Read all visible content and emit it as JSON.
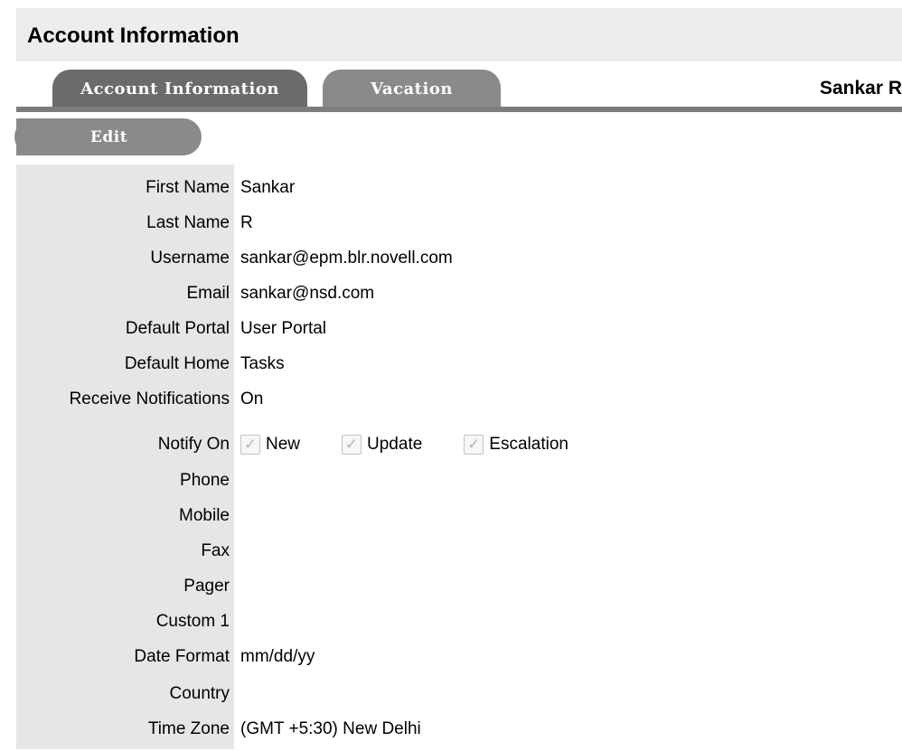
{
  "page": {
    "title": "Account Information"
  },
  "tabs": [
    {
      "label": "Account Information",
      "active": true
    },
    {
      "label": "Vacation",
      "active": false
    }
  ],
  "user": {
    "display_name": "Sankar R"
  },
  "toolbar": {
    "edit_label": "Edit"
  },
  "fields": {
    "first_name": {
      "label": "First Name",
      "value": "Sankar"
    },
    "last_name": {
      "label": "Last Name",
      "value": "R"
    },
    "username": {
      "label": "Username",
      "value": "sankar@epm.blr.novell.com"
    },
    "email": {
      "label": "Email",
      "value": "sankar@nsd.com"
    },
    "default_portal": {
      "label": "Default Portal",
      "value": "User Portal"
    },
    "default_home": {
      "label": "Default Home",
      "value": "Tasks"
    },
    "receive_notifications": {
      "label": "Receive Notifications",
      "value": "On"
    },
    "notify_on": {
      "label": "Notify On",
      "options": [
        {
          "label": "New",
          "checked": true
        },
        {
          "label": "Update",
          "checked": true
        },
        {
          "label": "Escalation",
          "checked": true
        }
      ]
    },
    "phone": {
      "label": "Phone",
      "value": ""
    },
    "mobile": {
      "label": "Mobile",
      "value": ""
    },
    "fax": {
      "label": "Fax",
      "value": ""
    },
    "pager": {
      "label": "Pager",
      "value": ""
    },
    "custom1": {
      "label": "Custom 1",
      "value": ""
    },
    "date_format": {
      "label": "Date Format",
      "value": "mm/dd/yy"
    },
    "country": {
      "label": "Country",
      "value": ""
    },
    "time_zone": {
      "label": "Time Zone",
      "value": "(GMT +5:30) New Delhi"
    }
  },
  "colors": {
    "header_bg": "#ededed",
    "tab_active": "#6b6b6b",
    "tab_inactive": "#8a8a8a",
    "label_column_bg": "#e6e6e6"
  },
  "icons": {
    "checkbox_checked": "check-icon"
  }
}
